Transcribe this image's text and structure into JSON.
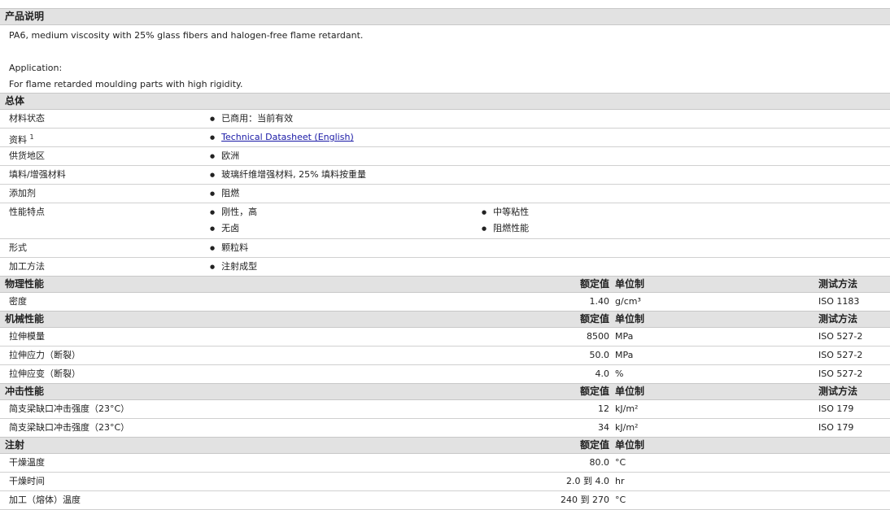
{
  "description": {
    "title": "产品说明",
    "line1": "PA6, medium viscosity with 25% glass fibers and halogen-free flame retardant.",
    "app_label": "Application:",
    "app_text": "For flame retarded moulding parts with high rigidity."
  },
  "general": {
    "title": "总体",
    "rows": [
      {
        "label": "材料状态",
        "value": "已商用：当前有效"
      },
      {
        "label": "资料",
        "sup": "1",
        "value": "Technical Datasheet (English)"
      },
      {
        "label": "供货地区",
        "value": "欧洲"
      },
      {
        "label": "填料/增强材料",
        "value": "玻璃纤维增强材料, 25% 填料按重量"
      },
      {
        "label": "添加剂",
        "value": "阻燃"
      },
      {
        "label": "性能特点",
        "values": [
          "刚性，高",
          "中等粘性",
          "无卤",
          "阻燃性能"
        ]
      },
      {
        "label": "形式",
        "value": "颗粒料"
      },
      {
        "label": "加工方法",
        "value": "注射成型"
      }
    ]
  },
  "headers": {
    "value": "额定值",
    "unit": "单位制",
    "method": "测试方法"
  },
  "physical": {
    "title": "物理性能",
    "rows": [
      {
        "label": "密度",
        "value": "1.40",
        "unit": "g/cm³",
        "method": "ISO 1183"
      }
    ]
  },
  "mechanical": {
    "title": "机械性能",
    "rows": [
      {
        "label": "拉伸模量",
        "value": "8500",
        "unit": "MPa",
        "method": "ISO 527-2"
      },
      {
        "label": "拉伸应力（断裂）",
        "value": "50.0",
        "unit": "MPa",
        "method": "ISO 527-2"
      },
      {
        "label": "拉伸应变（断裂）",
        "value": "4.0",
        "unit": "%",
        "method": "ISO 527-2"
      }
    ]
  },
  "impact": {
    "title": "冲击性能",
    "rows": [
      {
        "label": "简支梁缺口冲击强度（23°C）",
        "value": "12",
        "unit": "kJ/m²",
        "method": "ISO 179"
      },
      {
        "label": "简支梁缺口冲击强度（23°C）",
        "value": "34",
        "unit": "kJ/m²",
        "method": "ISO 179"
      }
    ]
  },
  "injection": {
    "title": "注射",
    "rows": [
      {
        "label": "干燥温度",
        "value": "80.0",
        "unit": "°C"
      },
      {
        "label": "干燥时间",
        "value": "2.0 到 4.0",
        "unit": "hr"
      },
      {
        "label": "加工（熔体）温度",
        "value": "240 到 270",
        "unit": "°C"
      }
    ]
  }
}
